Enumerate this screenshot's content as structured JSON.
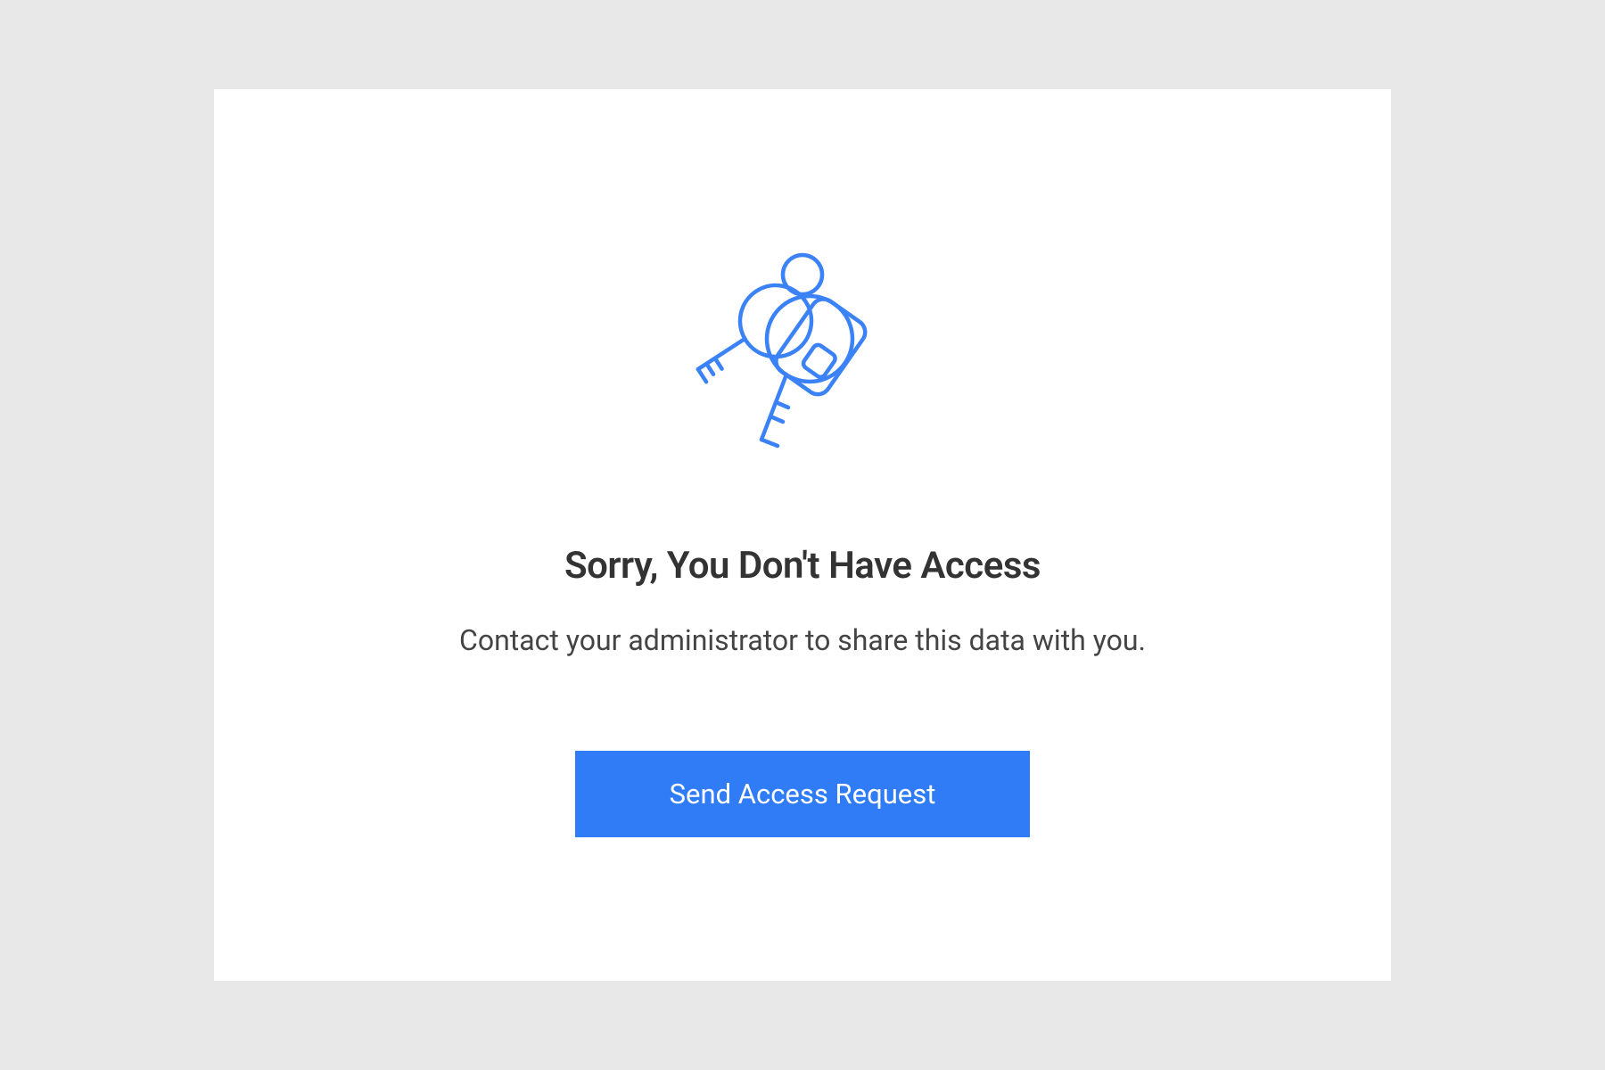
{
  "access_denied": {
    "heading": "Sorry, You Don't Have Access",
    "subheading": "Contact your administrator to share this data with you.",
    "cta_label": "Send Access Request",
    "icon_name": "keys-icon",
    "accent_color": "#2f7cf6"
  }
}
